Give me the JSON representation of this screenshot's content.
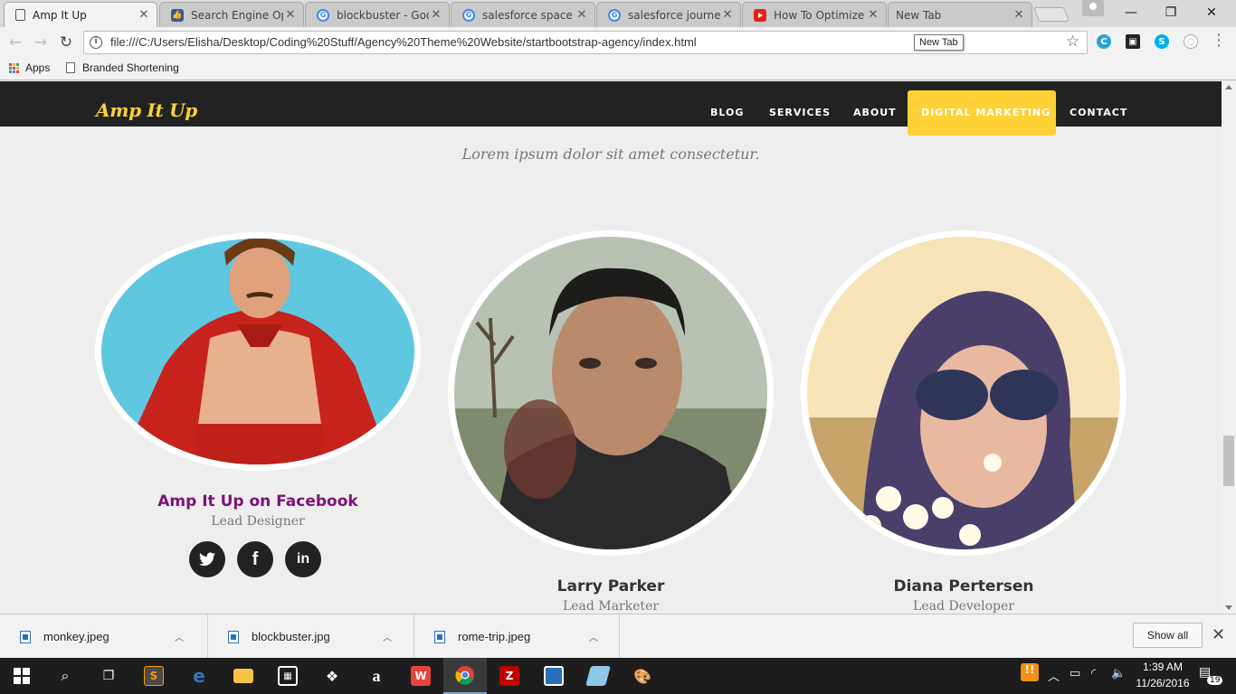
{
  "browser": {
    "tabs": [
      {
        "title": "Amp It Up",
        "icon": "page-icon",
        "active": true
      },
      {
        "title": "Search Engine Opti",
        "icon": "seo-icon",
        "active": false
      },
      {
        "title": "blockbuster - Goo",
        "icon": "google-icon",
        "active": false
      },
      {
        "title": "salesforce space -",
        "icon": "google-icon",
        "active": false
      },
      {
        "title": "salesforce journey",
        "icon": "google-icon",
        "active": false
      },
      {
        "title": "How To Optimize Y",
        "icon": "youtube-icon",
        "active": false
      },
      {
        "title": "New Tab",
        "icon": "none",
        "active": false
      }
    ],
    "url": "file:///C:/Users/Elisha/Desktop/Coding%20Stuff/Agency%20Theme%20Website/startbootstrap-agency/index.html",
    "tooltip": "New Tab",
    "bookmarks": [
      {
        "label": "Apps",
        "icon": "apps-grid-icon"
      },
      {
        "label": "Branded Shortening",
        "icon": "page-icon"
      }
    ]
  },
  "site": {
    "brand": "Amp It Up",
    "nav": [
      "BLOG",
      "SERVICES",
      "ABOUT",
      "DIGITAL MARKETING",
      "CONTACT"
    ],
    "subheading": "Lorem ipsum dolor sit amet consectetur.",
    "team": [
      {
        "name": "Amp It Up on Facebook",
        "role": "Lead Designer"
      },
      {
        "name": "Larry Parker",
        "role": "Lead Marketer"
      },
      {
        "name": "Diana Pertersen",
        "role": "Lead Developer"
      }
    ],
    "social": [
      "twitter-icon",
      "facebook-icon",
      "linkedin-icon"
    ],
    "colors": {
      "accent": "#fed136",
      "dark": "#222222",
      "link": "#7a1377"
    }
  },
  "downloads": {
    "files": [
      "monkey.jpeg",
      "blockbuster.jpg",
      "rome-trip.jpeg"
    ],
    "show_all": "Show all"
  },
  "taskbar": {
    "time": "1:39 AM",
    "date": "11/26/2016",
    "notifications": "19"
  }
}
